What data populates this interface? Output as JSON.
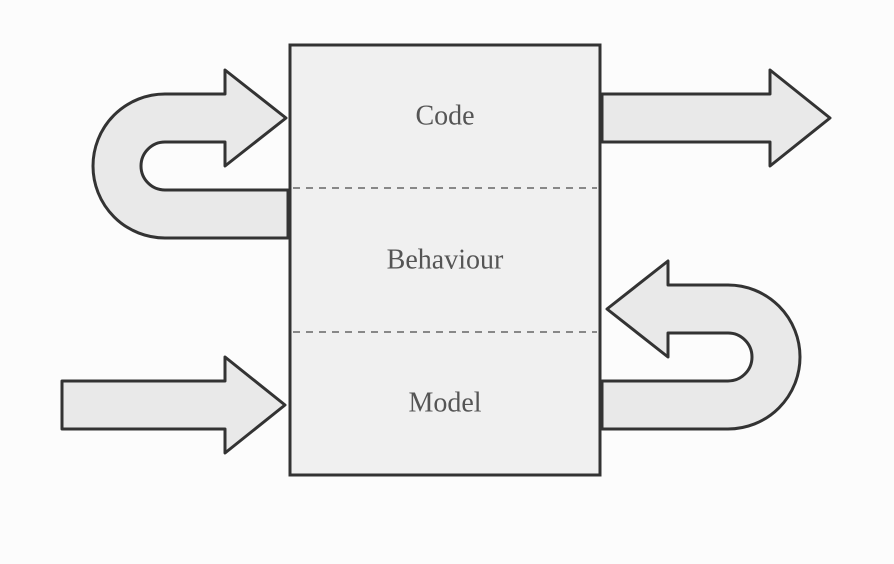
{
  "diagram": {
    "sections": {
      "top": "Code",
      "middle": "Behaviour",
      "bottom": "Model"
    },
    "colors": {
      "boxFill": "#f0f0f0",
      "arrowFill": "#e9e9e9",
      "stroke": "#333333",
      "dash": "#888888"
    }
  }
}
